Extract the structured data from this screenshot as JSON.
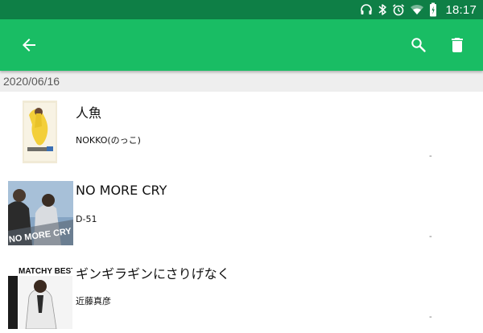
{
  "status": {
    "time": "18:17"
  },
  "date_header": "2020/06/16",
  "items": [
    {
      "title": "人魚",
      "artist": "NOKKO(のっこ)",
      "meta": "-"
    },
    {
      "title": "NO MORE CRY",
      "artist": "D-51",
      "meta": "-",
      "cover_text": "NO MORE CRY D-51"
    },
    {
      "title": "ギンギラギンにさりげなく",
      "artist": "近藤真彦",
      "meta": "-",
      "cover_text": "MATCHY BEST"
    }
  ],
  "colors": {
    "app_bar": "#19bd64",
    "status_bar": "#0e7f46",
    "date_header_bg": "#eeeeee"
  },
  "icons": [
    "headphones-icon",
    "bluetooth-icon",
    "alarm-icon",
    "wifi-icon",
    "battery-icon",
    "back-arrow-icon",
    "search-icon",
    "delete-icon"
  ]
}
